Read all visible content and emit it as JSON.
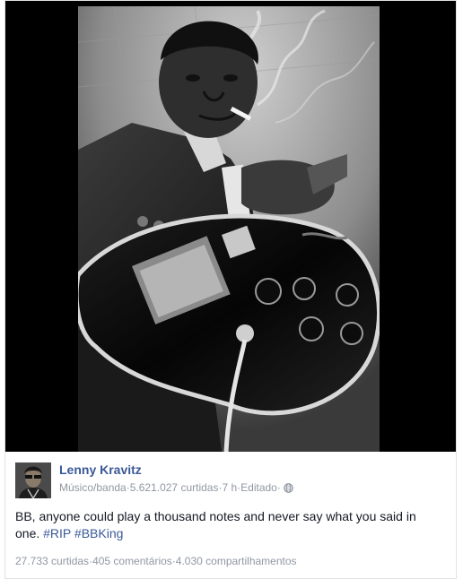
{
  "post": {
    "author": "Lenny Kravitz",
    "category": "Músico/banda",
    "likes_text": "5.621.027 curtidas",
    "time": "7 h",
    "edited": "Editado",
    "separator": " · ",
    "message": "BB, anyone could play a thousand notes and never say what you said in one. ",
    "hashtags": [
      "#RIP",
      "#BBKing"
    ],
    "stats": {
      "likes": "27.733 curtidas",
      "comments": "405 comentários",
      "shares": "4.030 compartilhamentos"
    }
  },
  "icons": {
    "privacy": "globe-icon"
  },
  "colors": {
    "link": "#3b5998",
    "meta": "#9197a3",
    "text": "#141823"
  }
}
